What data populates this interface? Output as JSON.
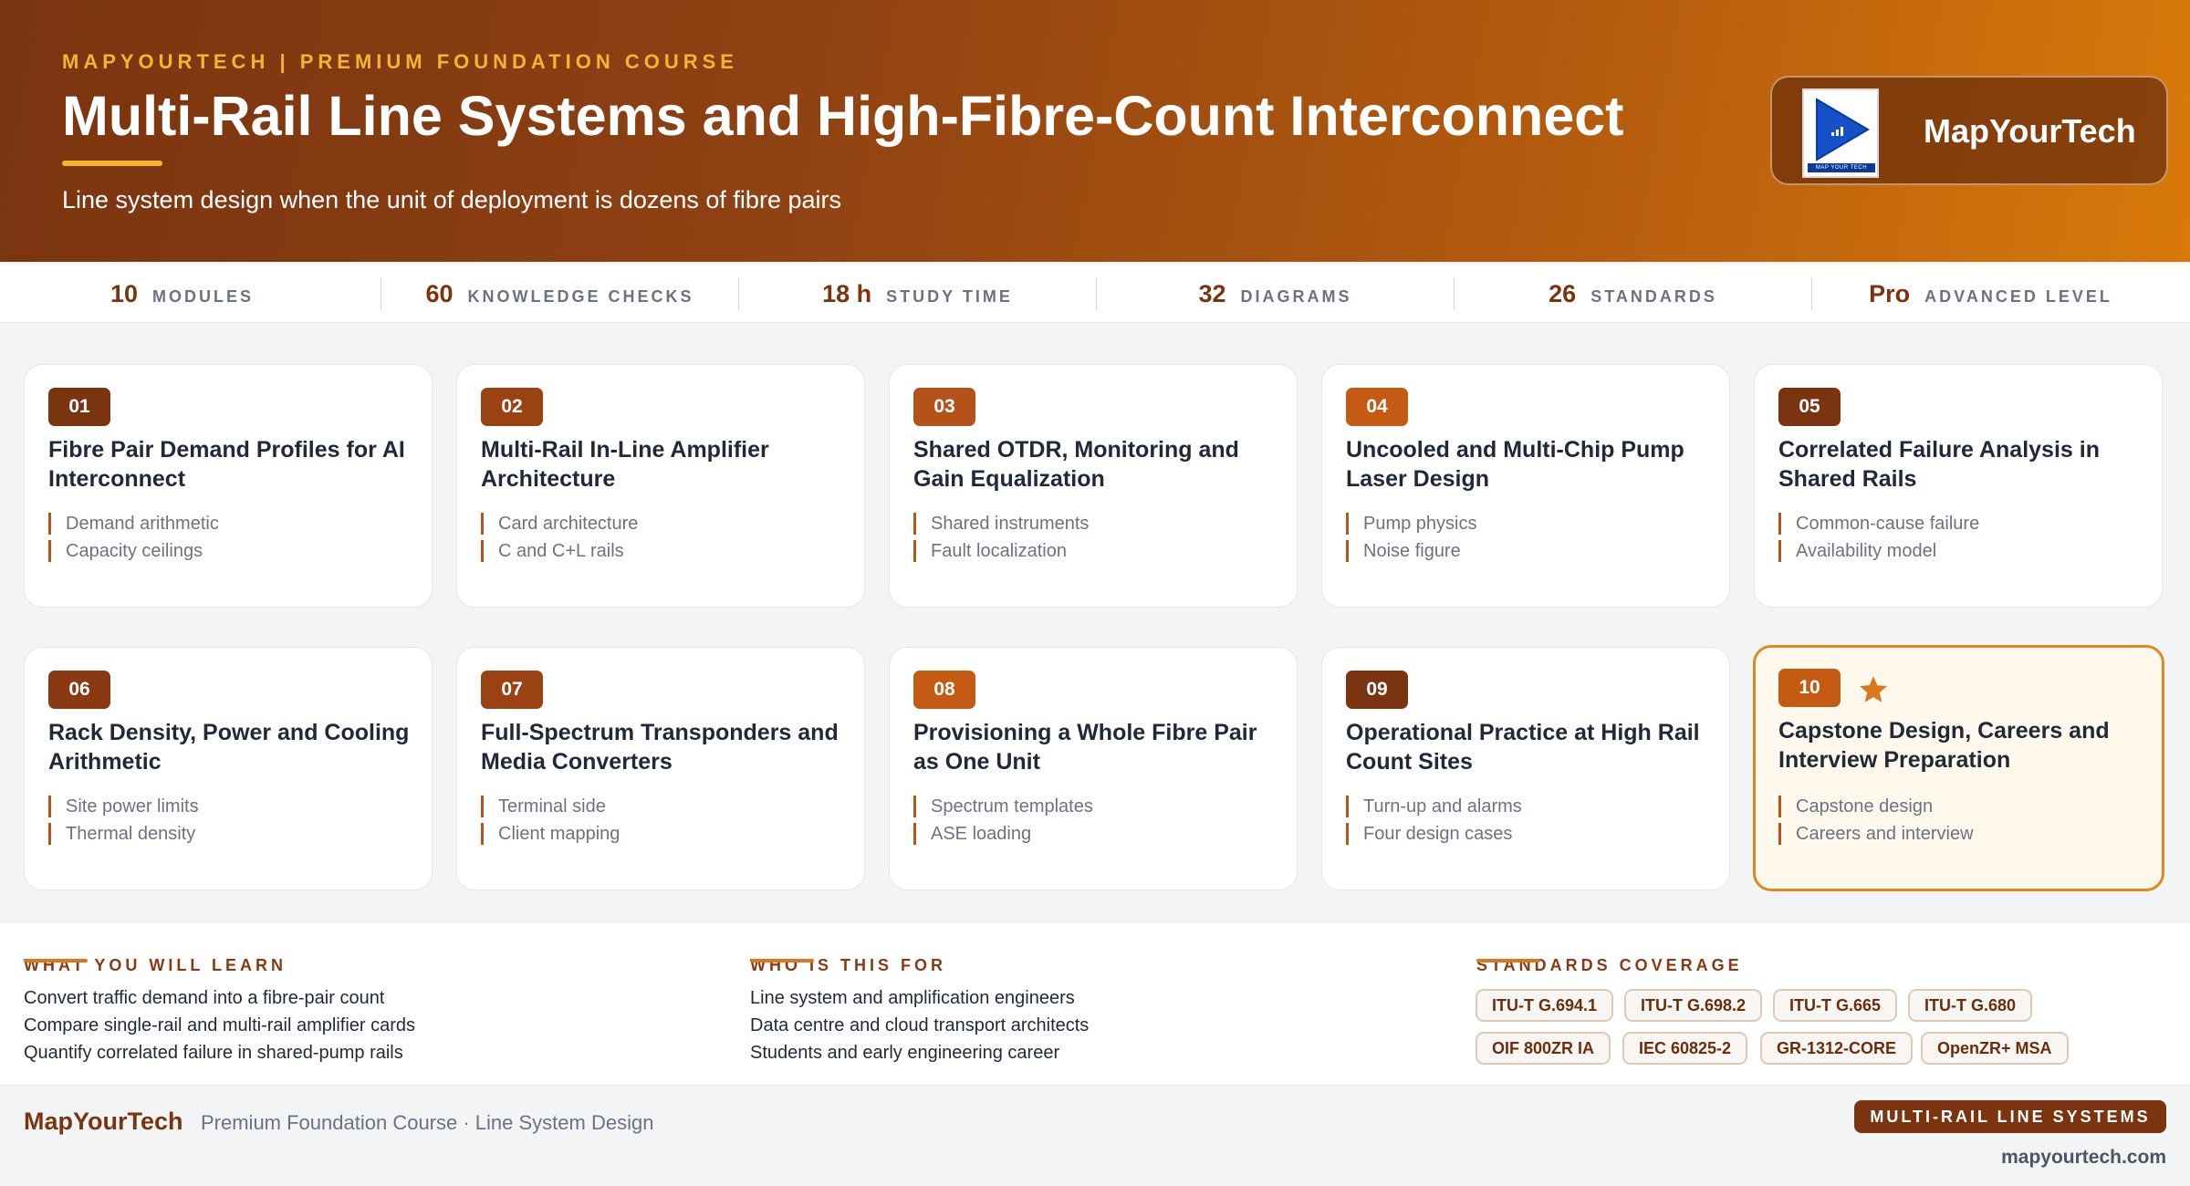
{
  "header": {
    "kicker": "MAPYOURTECH | PREMIUM FOUNDATION COURSE",
    "title": "Multi-Rail Line Systems and High-Fibre-Count Interconnect",
    "subtitle": "Line system design when the unit of deployment is dozens of fibre pairs",
    "brand_name": "MapYourTech",
    "logo_band_text": "MAP YOUR TECH"
  },
  "stats": [
    {
      "value": "10",
      "label": "MODULES"
    },
    {
      "value": "60",
      "label": "KNOWLEDGE CHECKS"
    },
    {
      "value": "18 h",
      "label": "STUDY TIME"
    },
    {
      "value": "32",
      "label": "DIAGRAMS"
    },
    {
      "value": "26",
      "label": "STANDARDS"
    },
    {
      "value": "Pro",
      "label": "ADVANCED LEVEL"
    }
  ],
  "modules": [
    {
      "num": "01",
      "title": "Fibre Pair Demand Profiles for AI Interconnect",
      "topics": [
        "Demand arithmetic",
        "Capacity ceilings"
      ],
      "badge_color": "#7a3410"
    },
    {
      "num": "02",
      "title": "Multi-Rail In-Line Amplifier Architecture",
      "topics": [
        "Card architecture",
        "C and C+L rails"
      ],
      "badge_color": "#9a4211"
    },
    {
      "num": "03",
      "title": "Shared OTDR, Monitoring and Gain Equalization",
      "topics": [
        "Shared instruments",
        "Fault localization"
      ],
      "badge_color": "#b5521a"
    },
    {
      "num": "04",
      "title": "Uncooled and Multi-Chip Pump Laser Design",
      "topics": [
        "Pump physics",
        "Noise figure"
      ],
      "badge_color": "#c55a12"
    },
    {
      "num": "05",
      "title": "Correlated Failure Analysis in Shared Rails",
      "topics": [
        "Common-cause failure",
        "Availability model"
      ],
      "badge_color": "#7a3410"
    },
    {
      "num": "06",
      "title": "Rack Density, Power and Cooling Arithmetic",
      "topics": [
        "Site power limits",
        "Thermal density"
      ],
      "badge_color": "#8a3a12"
    },
    {
      "num": "07",
      "title": "Full-Spectrum Transponders and Media Converters",
      "topics": [
        "Terminal side",
        "Client mapping"
      ],
      "badge_color": "#9a4211"
    },
    {
      "num": "08",
      "title": "Provisioning a Whole Fibre Pair as One Unit",
      "topics": [
        "Spectrum templates",
        "ASE loading"
      ],
      "badge_color": "#c55a12"
    },
    {
      "num": "09",
      "title": "Operational Practice at High Rail Count Sites",
      "topics": [
        "Turn-up and alarms",
        "Four design cases"
      ],
      "badge_color": "#7a3410"
    },
    {
      "num": "10",
      "title": "Capstone Design, Careers and Interview Preparation",
      "topics": [
        "Capstone design",
        "Careers and interview"
      ],
      "badge_color": "#c55a12",
      "featured": true,
      "icon": "star-icon"
    }
  ],
  "learn": {
    "heading": "WHAT YOU WILL LEARN",
    "items": [
      "Convert traffic demand into a fibre-pair count",
      "Compare single-rail and multi-rail amplifier cards",
      "Quantify correlated failure in shared-pump rails"
    ]
  },
  "audience": {
    "heading": "WHO IS THIS FOR",
    "items": [
      "Line system and amplification engineers",
      "Data centre and cloud transport architects",
      "Students and early engineering career"
    ]
  },
  "standards": {
    "heading": "STANDARDS COVERAGE",
    "row1": [
      "ITU-T G.694.1",
      "ITU-T G.698.2",
      "ITU-T G.665",
      "ITU-T G.680"
    ],
    "row2": [
      "OIF 800ZR IA",
      "IEC 60825-2",
      "GR-1312-CORE",
      "OpenZR+ MSA"
    ]
  },
  "footer": {
    "brand": "MapYourTech",
    "text": "Premium Foundation Course · Line System Design",
    "tag": "MULTI-RAIL LINE SYSTEMS",
    "url": "mapyourtech.com"
  },
  "colors": {
    "accent_gold": "#f5b332",
    "brand_brown": "#7a3410",
    "featured_border": "#e08a1e"
  }
}
